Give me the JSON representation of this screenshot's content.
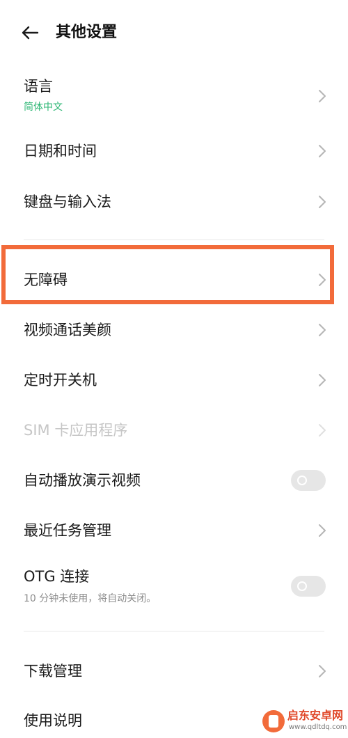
{
  "header": {
    "title": "其他设置",
    "back_icon": "arrow-left-icon"
  },
  "items": [
    {
      "label": "语言",
      "sub": "简体中文",
      "control": "chevron"
    },
    {
      "label": "日期和时间",
      "control": "chevron"
    },
    {
      "label": "键盘与输入法",
      "control": "chevron"
    },
    {
      "label": "无障碍",
      "control": "chevron",
      "highlighted": true
    },
    {
      "label": "视频通话美颜",
      "control": "chevron"
    },
    {
      "label": "定时开关机",
      "control": "chevron"
    },
    {
      "label": "SIM 卡应用程序",
      "control": "chevron",
      "disabled": true
    },
    {
      "label": "自动播放演示视频",
      "control": "toggle",
      "toggle_state": "off"
    },
    {
      "label": "最近任务管理",
      "control": "chevron"
    },
    {
      "label": "OTG 连接",
      "sub": "10 分钟未使用，将自动关闭。",
      "control": "toggle",
      "toggle_state": "off"
    },
    {
      "label": "下载管理",
      "control": "chevron"
    },
    {
      "label": "使用说明",
      "control": "none"
    }
  ],
  "watermark": {
    "name": "启东安卓网",
    "url": "www.qdltdq.com"
  },
  "colors": {
    "accent_green": "#2bb673",
    "highlight_orange": "#f26b3a",
    "chevron_gray": "#b5b5b5",
    "toggle_track": "#e6e6e6",
    "disabled_text": "#c6c6c6"
  }
}
